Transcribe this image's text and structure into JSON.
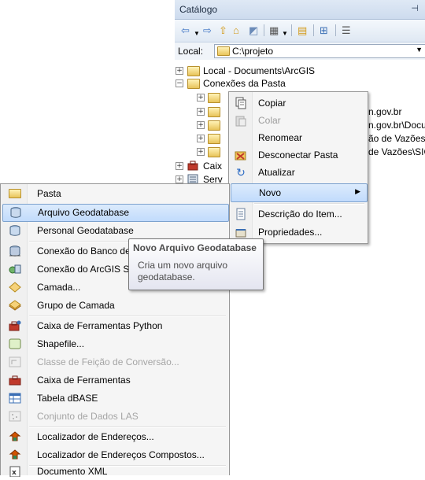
{
  "catalog": {
    "title": "Catálogo",
    "pin": "⊣",
    "location_label": "Local:",
    "location_value": "C:\\projeto"
  },
  "tree": {
    "items": [
      {
        "label": "Local - Documents\\ArcGIS"
      },
      {
        "label": "Conexões da Pasta"
      },
      {
        "label": ""
      },
      {
        "label": "n.gov.br"
      },
      {
        "label": "n.gov.br\\Docu"
      },
      {
        "label": "ão de Vazões"
      },
      {
        "label": "de Vazões\\SIG"
      },
      {
        "label": "Caix"
      },
      {
        "label": "Serv"
      }
    ]
  },
  "context_menu": {
    "items": [
      {
        "label": "Copiar"
      },
      {
        "label": "Colar"
      },
      {
        "label": "Renomear"
      },
      {
        "label": "Desconectar Pasta"
      },
      {
        "label": "Atualizar"
      },
      {
        "label": "Novo"
      },
      {
        "label": "Descrição do Item..."
      },
      {
        "label": "Propriedades..."
      }
    ]
  },
  "new_menu": {
    "items": [
      {
        "label": "Pasta"
      },
      {
        "label": "Arquivo Geodatabase"
      },
      {
        "label": "Personal Geodatabase"
      },
      {
        "label": "Conexão do Banco de"
      },
      {
        "label": "Conexão do ArcGIS Se"
      },
      {
        "label": "Camada..."
      },
      {
        "label": "Grupo de Camada"
      },
      {
        "label": "Caixa de Ferramentas Python"
      },
      {
        "label": "Shapefile..."
      },
      {
        "label": "Classe de Feição de Conversão..."
      },
      {
        "label": "Caixa de Ferramentas"
      },
      {
        "label": "Tabela dBASE"
      },
      {
        "label": "Conjunto de Dados LAS"
      },
      {
        "label": "Localizador de Endereços..."
      },
      {
        "label": "Localizador de Endereços Compostos..."
      },
      {
        "label": "Documento XML"
      }
    ]
  },
  "tooltip": {
    "title": "Novo Arquivo Geodatabase",
    "body": "Cria um novo arquivo geodatabase."
  },
  "colors": {
    "highlight": "#c1dbfc",
    "highlight_border": "#7da2ce"
  }
}
